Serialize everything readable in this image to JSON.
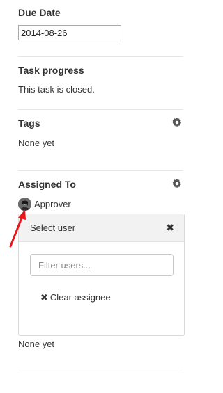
{
  "due_date": {
    "title": "Due Date",
    "value": "2014-08-26"
  },
  "task_progress": {
    "title": "Task progress",
    "status_text": "This task is closed."
  },
  "tags": {
    "title": "Tags",
    "empty_text": "None yet",
    "settings_icon": "gear-icon"
  },
  "assigned_to": {
    "title": "Assigned To",
    "settings_icon": "gear-icon",
    "assignee_name": "Approver",
    "empty_text": "None yet",
    "dropdown": {
      "title": "Select user",
      "close_icon": "close-icon",
      "filter_placeholder": "Filter users...",
      "clear_label": "Clear assignee",
      "clear_icon": "close-icon"
    }
  },
  "annotation": {
    "arrow_color": "#e8151b"
  }
}
